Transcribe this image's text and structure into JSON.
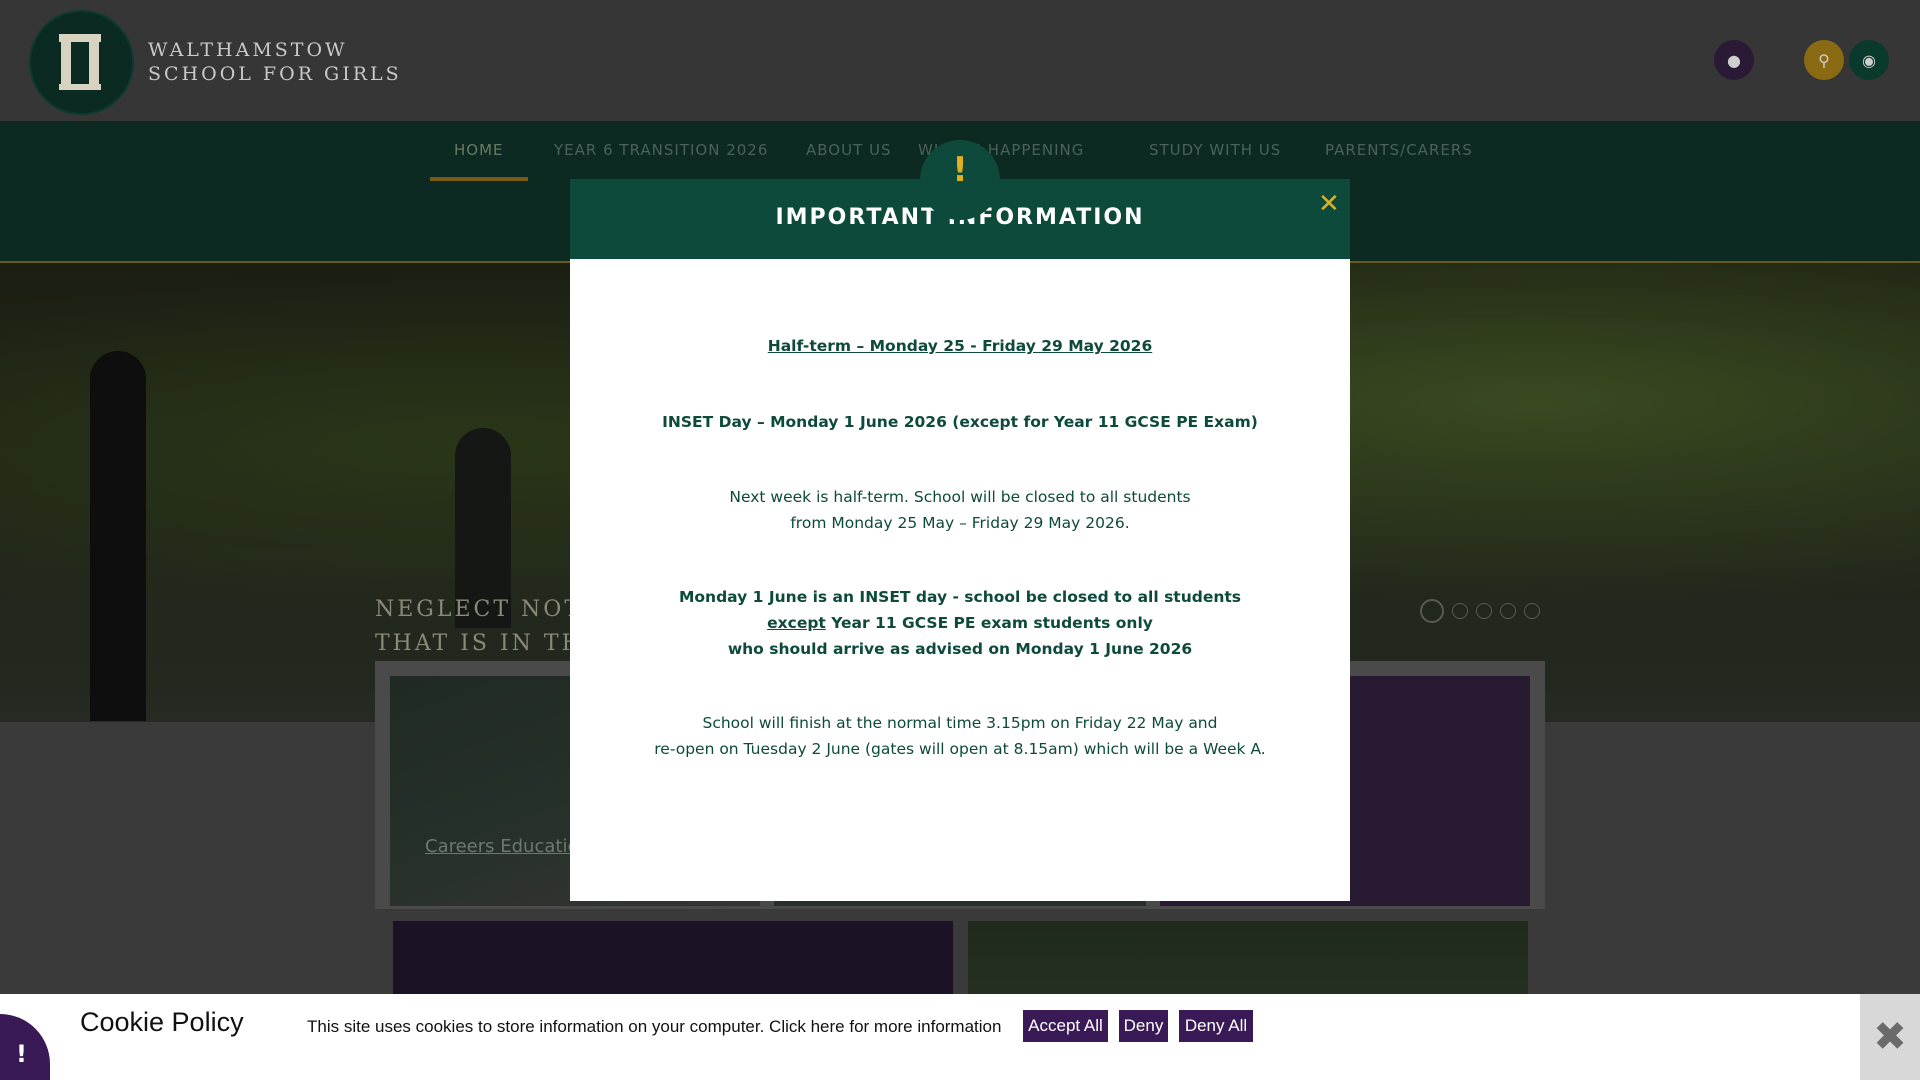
{
  "header": {
    "brand_line1": "WALTHAMSTOW",
    "brand_line2": "SCHOOL FOR GIRLS",
    "icons": [
      "user-icon",
      "search-icon",
      "globe-icon"
    ]
  },
  "nav": {
    "items": [
      {
        "label": "HOME"
      },
      {
        "label": "YEAR 6 TRANSITION 2026"
      },
      {
        "label": "ABOUT US"
      },
      {
        "label": "WHAT'S HAPPENING"
      },
      {
        "label": "STUDY WITH US"
      },
      {
        "label": "PARENTS/CARERS"
      }
    ]
  },
  "hero": {
    "motto_line1": "NEGLECT NOT",
    "motto_line2": "THAT IS IN THE"
  },
  "cards": {
    "c1_link": "Careers Education"
  },
  "modal": {
    "title": "IMPORTANT INFORMATION",
    "alert_mark": "!",
    "close_glyph": "✕",
    "halfterm": "Half-term – Monday 25 - Friday 29 May 2026",
    "inset": "INSET Day – Monday 1 June 2026 (except for Year 11 GCSE PE Exam)",
    "p1_line1": "Next week is half-term. School will be closed to all students",
    "p1_line2": "from Monday 25 May – Friday 29 May 2026.",
    "p2_line1": "Monday 1 June is an INSET day - school be closed to all students",
    "p2_line2_u": "except",
    "p2_line2_rest": " Year 11 GCSE PE exam students only",
    "p2_line3": "who should arrive as advised on Monday 1 June 2026",
    "p3_line1": "School will finish at the normal time 3.15pm on Friday 22 May and",
    "p3_line2": "re-open on Tuesday 2 June (gates will open at 8.15am) which will be a Week A."
  },
  "cookie": {
    "title": "Cookie Policy",
    "text": "This site uses cookies to store information on your computer. Click here for more information",
    "accept_all": "Accept All",
    "deny": "Deny",
    "deny_all": "Deny All",
    "badge_mark": "!",
    "close_glyph": "✖"
  },
  "colors": {
    "brand_green": "#0d4a3b",
    "accent_gold": "#e0b020",
    "cookie_purple": "#3a1a56"
  }
}
